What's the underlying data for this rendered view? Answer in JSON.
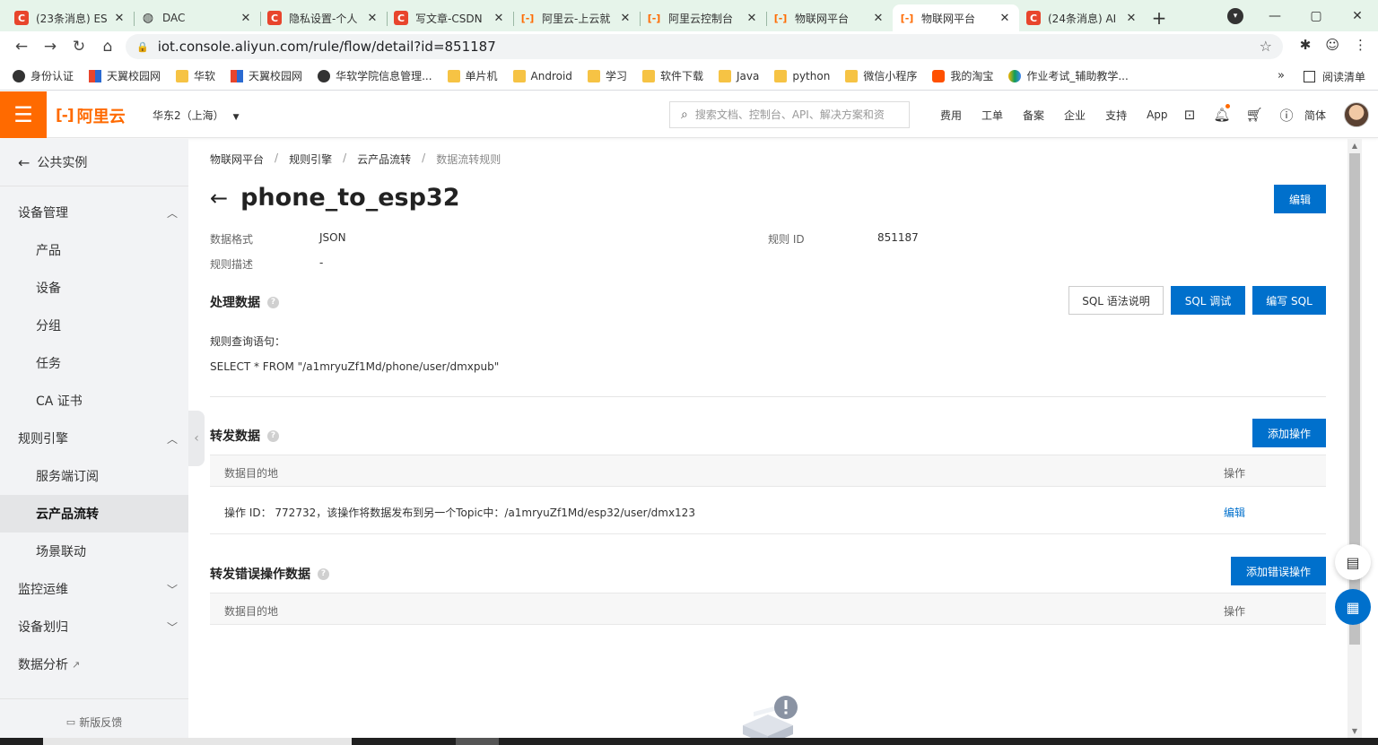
{
  "browser": {
    "tabs": [
      {
        "favicon": "C",
        "fav_class": "fav-c",
        "title": "(23条消息) ES"
      },
      {
        "favicon": "◍",
        "fav_class": "fav-dac",
        "title": "DAC"
      },
      {
        "favicon": "C",
        "fav_class": "fav-c",
        "title": "隐私设置-个人"
      },
      {
        "favicon": "C",
        "fav_class": "fav-c",
        "title": "写文章-CSDN"
      },
      {
        "favicon": "[-]",
        "fav_class": "fav-ali",
        "title": "阿里云-上云就"
      },
      {
        "favicon": "[-]",
        "fav_class": "fav-ali",
        "title": "阿里云控制台"
      },
      {
        "favicon": "[-]",
        "fav_class": "fav-ali",
        "title": "物联网平台"
      },
      {
        "favicon": "[-]",
        "fav_class": "fav-ali",
        "title": "物联网平台",
        "active": true
      },
      {
        "favicon": "C",
        "fav_class": "fav-c",
        "title": "(24条消息) AI"
      }
    ],
    "url": "iot.console.aliyun.com/rule/flow/detail?id=851187",
    "bookmarks": [
      {
        "icon": "ic-globe",
        "label": "身份认证"
      },
      {
        "icon": "ic-tianyi",
        "label": "天翼校园网"
      },
      {
        "icon": "ic-folder",
        "label": "华软"
      },
      {
        "icon": "ic-tianyi",
        "label": "天翼校园网"
      },
      {
        "icon": "ic-globe",
        "label": "华软学院信息管理..."
      },
      {
        "icon": "ic-folder",
        "label": "单片机"
      },
      {
        "icon": "ic-folder",
        "label": "Android"
      },
      {
        "icon": "ic-folder",
        "label": "学习"
      },
      {
        "icon": "ic-folder",
        "label": "软件下载"
      },
      {
        "icon": "ic-folder",
        "label": "Java"
      },
      {
        "icon": "ic-folder",
        "label": "python"
      },
      {
        "icon": "ic-folder",
        "label": "微信小程序"
      },
      {
        "icon": "ic-taobao",
        "label": "我的淘宝"
      },
      {
        "icon": "ic-hw",
        "label": "作业考试_辅助教学..."
      }
    ],
    "bookmarks_more": "»",
    "reading_list": "阅读清单"
  },
  "console": {
    "logo_text": "阿里云",
    "region": "华东2（上海）",
    "search_placeholder": "搜索文档、控制台、API、解决方案和资",
    "top_links": [
      "费用",
      "工单",
      "备案",
      "企业",
      "支持",
      "App"
    ],
    "lang": "简体"
  },
  "sidebar": {
    "back_label": "公共实例",
    "groups": [
      {
        "label": "设备管理",
        "expanded": true,
        "items": [
          "产品",
          "设备",
          "分组",
          "任务",
          "CA 证书"
        ]
      },
      {
        "label": "规则引擎",
        "expanded": true,
        "items": [
          "服务端订阅",
          "云产品流转",
          "场景联动"
        ]
      },
      {
        "label": "监控运维",
        "expanded": false,
        "items": []
      },
      {
        "label": "设备划归",
        "expanded": false,
        "items": []
      }
    ],
    "active_item": "云产品流转",
    "data_analysis": "数据分析",
    "feedback": "新版反馈"
  },
  "page": {
    "breadcrumb": [
      "物联网平台",
      "规则引擎",
      "云产品流转",
      "数据流转规则"
    ],
    "title": "phone_to_esp32",
    "edit_label": "编辑",
    "meta": {
      "format_label": "数据格式",
      "format_value": "JSON",
      "rule_id_label": "规则 ID",
      "rule_id_value": "851187",
      "desc_label": "规则描述",
      "desc_value": "-"
    },
    "process": {
      "title": "处理数据",
      "sql_help": "SQL 语法说明",
      "sql_debug": "SQL 调试",
      "sql_write": "编写 SQL",
      "query_label": "规则查询语句：",
      "query": "SELECT * FROM \"/a1mryuZf1Md/phone/user/dmxpub\""
    },
    "forward": {
      "title": "转发数据",
      "add_label": "添加操作",
      "col_dest": "数据目的地",
      "col_op": "操作",
      "rows": [
        {
          "dest": "操作 ID： 772732，该操作将数据发布到另一个Topic中：/a1mryuZf1Md/esp32/user/dmx123",
          "op": "编辑"
        }
      ]
    },
    "error_forward": {
      "title": "转发错误操作数据",
      "add_label": "添加错误操作",
      "col_dest": "数据目的地",
      "col_op": "操作"
    }
  },
  "colors": {
    "primary": "#0070cc",
    "brand": "#ff6a00",
    "tabstrip": "#e6f4ea",
    "sidebar": "#f2f3f5"
  }
}
